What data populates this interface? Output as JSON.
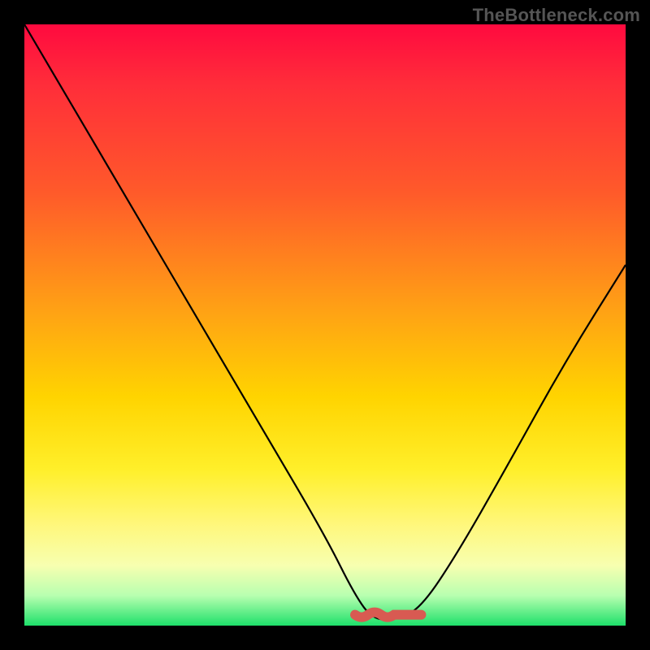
{
  "watermark": "TheBottleneck.com",
  "chart_data": {
    "type": "line",
    "title": "",
    "xlabel": "",
    "ylabel": "",
    "xlim": [
      0,
      100
    ],
    "ylim": [
      0,
      100
    ],
    "grid": false,
    "legend": false,
    "series": [
      {
        "name": "bottleneck-curve",
        "x": [
          0,
          10,
          20,
          30,
          40,
          50,
          55,
          58,
          62,
          66,
          72,
          80,
          90,
          100
        ],
        "values": [
          100,
          83,
          66,
          49,
          32,
          15,
          5,
          1,
          1,
          3,
          12,
          26,
          44,
          60
        ]
      }
    ],
    "gradient_stops": [
      {
        "pos": 0,
        "color": "#ff0a3f"
      },
      {
        "pos": 10,
        "color": "#ff2d3a"
      },
      {
        "pos": 28,
        "color": "#ff5a2a"
      },
      {
        "pos": 48,
        "color": "#ffa314"
      },
      {
        "pos": 62,
        "color": "#ffd400"
      },
      {
        "pos": 74,
        "color": "#ffef2a"
      },
      {
        "pos": 83,
        "color": "#fff77a"
      },
      {
        "pos": 90,
        "color": "#f7ffb0"
      },
      {
        "pos": 95,
        "color": "#b8ffb0"
      },
      {
        "pos": 100,
        "color": "#1ee06a"
      }
    ],
    "valley_marker": {
      "x_start": 55,
      "x_end": 66,
      "y": 1,
      "color": "#d85a52"
    }
  }
}
